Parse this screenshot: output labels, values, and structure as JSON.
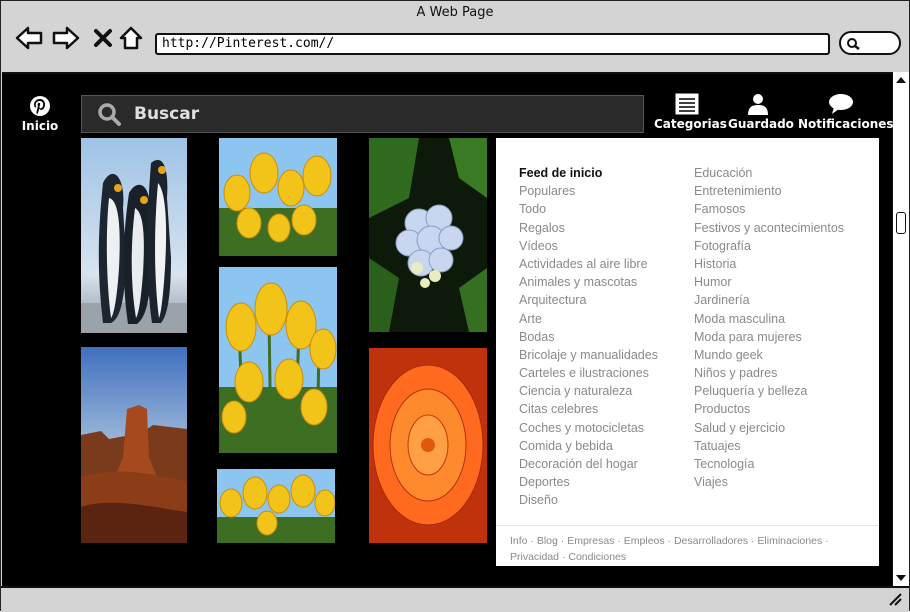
{
  "window": {
    "title": "A Web Page",
    "url": "http://Pinterest.com//"
  },
  "sidebar": {
    "home_label": "Inicio"
  },
  "search": {
    "placeholder": "Buscar"
  },
  "topnav": {
    "categories": "Categorias",
    "saved": "Guardado",
    "notifications": "Notificaciones"
  },
  "categories": {
    "left": [
      "Feed de inicio",
      "Populares",
      "Todo",
      "Regalos",
      "Vídeos",
      "Actividades al aire libre",
      "Animales y mascotas",
      "Arquitectura",
      "Arte",
      "Bodas",
      "Bricolaje y manualidades",
      "Carteles e ilustraciones",
      "Ciencia y naturaleza",
      "Citas celebres",
      "Coches y motocicletas",
      "Comida y bebida",
      "Decoración del hogar",
      "Deportes",
      "Diseño"
    ],
    "right": [
      "Educación",
      "Entretenimiento",
      "Famosos",
      "Festivos y acontecimientos",
      "Fotografía",
      "Historia",
      "Humor",
      "Jardinería",
      "Moda masculina",
      "Moda para mujeres",
      "Mundo geek",
      "Niños y padres",
      "Peluquería y belleza",
      "Productos",
      "Salud y ejercicio",
      "Tatuajes",
      "Tecnología",
      "Viajes"
    ]
  },
  "footer": {
    "line1": "Info · Blog · Empresas · Empleos · Desarrolladores · Eliminaciones ·",
    "line2": "Privacidad · Condiciones"
  },
  "colors": {
    "pinterest_red": "#bd081c",
    "frame": "#000000",
    "chrome": "#d4d4d4"
  }
}
